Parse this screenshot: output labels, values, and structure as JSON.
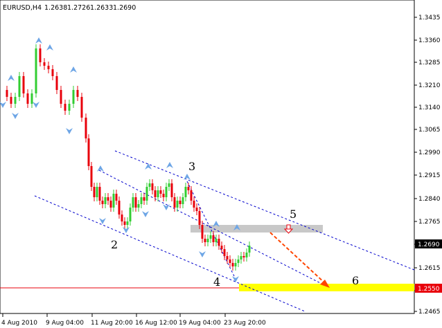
{
  "header": {
    "symbol": "EURUSD,H4",
    "open": "1.2638",
    "high": "1.2726",
    "low": "1.2633",
    "close": "1.2690"
  },
  "price_axis": {
    "ticks": [
      "1.3435",
      "1.3360",
      "1.3285",
      "1.3210",
      "1.3140",
      "1.3065",
      "1.2990",
      "1.2915",
      "1.2840",
      "1.2765",
      "1.2690",
      "1.2615",
      "1.2550",
      "1.2465"
    ],
    "current_price_tag": "1.2690",
    "level_tag": "1.2550"
  },
  "time_axis": {
    "labels": [
      "4 Aug 2010",
      "9 Aug 04:00",
      "11 Aug 20:00",
      "16 Aug 12:00",
      "19 Aug 04:00",
      "23 Aug 20:00"
    ]
  },
  "annotations": {
    "wave_2": "2",
    "wave_3": "3",
    "wave_4": "4",
    "wave_5": "5",
    "wave_6": "6"
  },
  "colors": {
    "bull_candle": "#32cd32",
    "bear_candle": "#e8000b",
    "channel_line": "#0000cd",
    "target_band": "#ffff00",
    "support_line": "#e8000b",
    "resistance_zone": "#c8c8c8",
    "forecast_arrow": "#ff4500",
    "fractal_arrow": "#6ea6e6"
  }
}
